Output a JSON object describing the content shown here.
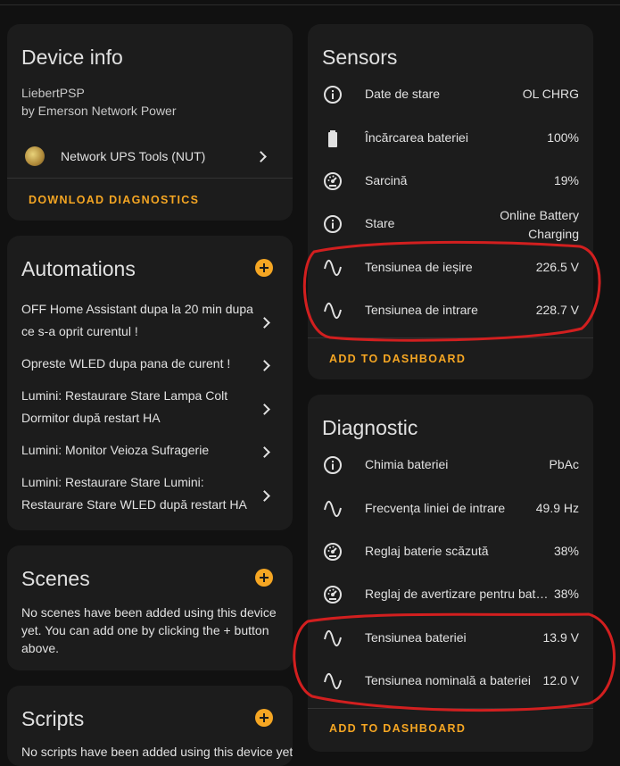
{
  "device_info": {
    "title": "Device info",
    "model": "LiebertPSP",
    "manufacturer": "by Emerson Network Power",
    "integration": "Network UPS Tools (NUT)",
    "action": "DOWNLOAD DIAGNOSTICS"
  },
  "automations": {
    "title": "Automations",
    "items": [
      {
        "label": "OFF Home Assistant dupa la 20 min dupa ce s-a oprit curentul !"
      },
      {
        "label": "Opreste WLED dupa pana de curent !"
      },
      {
        "label": "Lumini: Restaurare Stare Lampa Colt Dormitor după restart HA"
      },
      {
        "label": "Lumini: Monitor Veioza Sufragerie"
      },
      {
        "label": "Lumini: Restaurare Stare Lumini: Restaurare Stare WLED după restart HA"
      }
    ]
  },
  "scenes": {
    "title": "Scenes",
    "text": "No scenes have been added using this device yet. You can add one by clicking the + button above."
  },
  "scripts": {
    "title": "Scripts",
    "text": "No scripts have been added using this device yet."
  },
  "sensors": {
    "title": "Sensors",
    "rows": [
      {
        "name": "Date de stare",
        "value": "OL CHRG",
        "icon": "info-icon"
      },
      {
        "name": "Încărcarea bateriei",
        "value": "100%",
        "icon": "battery-icon"
      },
      {
        "name": "Sarcină",
        "value": "19%",
        "icon": "gauge-icon"
      },
      {
        "name": "Stare",
        "value_line1": "Online Battery",
        "value_line2": "Charging",
        "icon": "info-icon"
      },
      {
        "name": "Tensiunea de ieșire",
        "value": "226.5 V",
        "icon": "sine-wave-icon"
      },
      {
        "name": "Tensiunea de intrare",
        "value": "228.7 V",
        "icon": "sine-wave-icon"
      }
    ],
    "action": "ADD TO DASHBOARD"
  },
  "diagnostic": {
    "title": "Diagnostic",
    "rows": [
      {
        "name": "Chimia bateriei",
        "value": "PbAc",
        "icon": "info-icon"
      },
      {
        "name": "Frecvența liniei de intrare",
        "value": "49.9 Hz",
        "icon": "sine-wave-icon"
      },
      {
        "name": "Reglaj baterie scăzută",
        "value": "38%",
        "icon": "gauge-icon"
      },
      {
        "name": "Reglaj de avertizare pentru bat…",
        "value": "38%",
        "icon": "gauge-icon"
      },
      {
        "name": "Tensiunea bateriei",
        "value": "13.9 V",
        "icon": "sine-wave-icon"
      },
      {
        "name": "Tensiunea nominală a bateriei",
        "value": "12.0 V",
        "icon": "sine-wave-icon"
      }
    ],
    "action": "ADD TO DASHBOARD"
  },
  "colors": {
    "background": "#111111",
    "card": "#1c1c1c",
    "accent": "#f5a623",
    "annotation": "#d21f1f"
  }
}
